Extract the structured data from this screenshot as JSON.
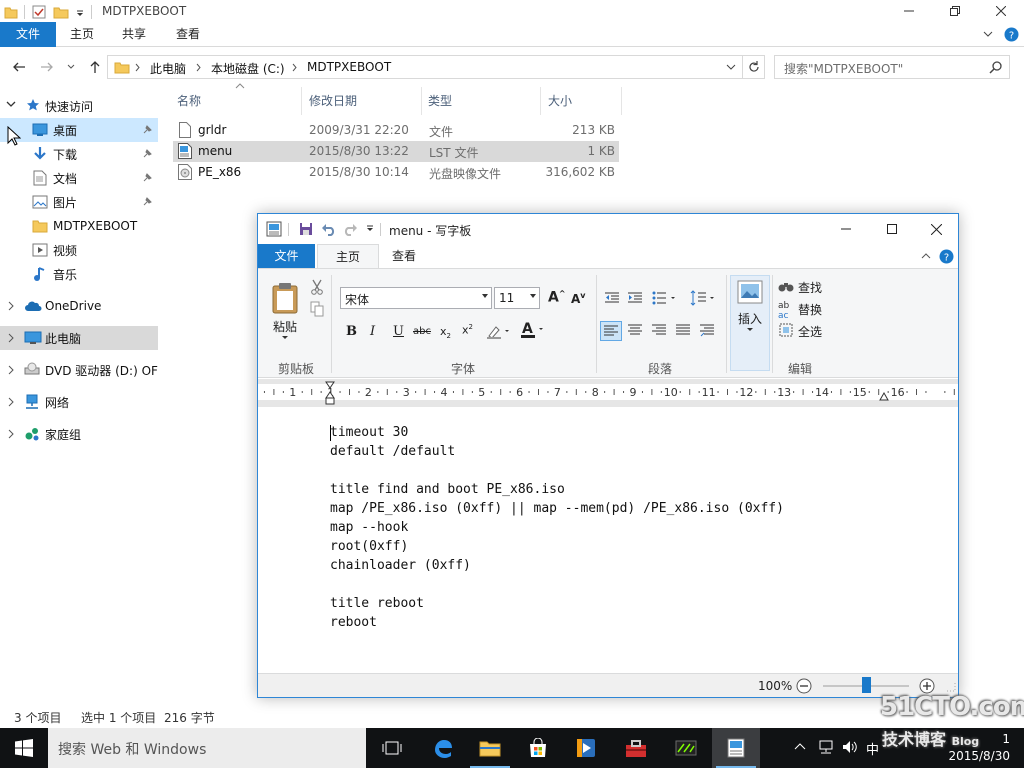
{
  "explorer": {
    "title": "MDTPXEBOOT",
    "tabs": {
      "file": "文件",
      "home": "主页",
      "share": "共享",
      "view": "查看"
    },
    "breadcrumb": [
      "此电脑",
      "本地磁盘 (C:)",
      "MDTPXEBOOT"
    ],
    "search_placeholder": "搜索\"MDTPXEBOOT\"",
    "nav": {
      "quick_access": "快速访问",
      "desktop": "桌面",
      "downloads": "下载",
      "documents": "文档",
      "pictures": "图片",
      "mdt": "MDTPXEBOOT",
      "videos": "视频",
      "music": "音乐",
      "onedrive": "OneDrive",
      "thispc": "此电脑",
      "dvd": "DVD 驱动器 (D:) OF",
      "network": "网络",
      "homegroup": "家庭组"
    },
    "columns": {
      "name": "名称",
      "date": "修改日期",
      "type": "类型",
      "size": "大小"
    },
    "files": [
      {
        "name": "grldr",
        "date": "2009/3/31 22:20",
        "type": "文件",
        "size": "213 KB"
      },
      {
        "name": "menu",
        "date": "2015/8/30 13:22",
        "type": "LST 文件",
        "size": "1 KB"
      },
      {
        "name": "PE_x86",
        "date": "2015/8/30 10:14",
        "type": "光盘映像文件",
        "size": "316,602 KB"
      }
    ],
    "status": {
      "count": "3 个项目",
      "selected": "选中 1 个项目",
      "size": "216 字节"
    }
  },
  "wordpad": {
    "title": "menu - 写字板",
    "tabs": {
      "file": "文件",
      "home": "主页",
      "view": "查看"
    },
    "clipboard": {
      "paste": "粘贴",
      "label": "剪贴板"
    },
    "font": {
      "name": "宋体",
      "size": "11",
      "label": "字体"
    },
    "paragraph_label": "段落",
    "insert": {
      "label": "插入"
    },
    "edit": {
      "find": "查找",
      "replace": "替换",
      "select_all": "全选",
      "label": "编辑"
    },
    "ruler": [
      "1",
      "1",
      "2",
      "3",
      "4",
      "5",
      "6",
      "7",
      "8",
      "9",
      "10",
      "11",
      "12",
      "13",
      "14",
      "15",
      "16"
    ],
    "content": "timeout 30\ndefault /default\n\ntitle find and boot PE_x86.iso\nmap /PE_x86.iso (0xff) || map --mem(pd) /PE_x86.iso (0xff)\nmap --hook\nroot(0xff)\nchainloader (0xff)\n\ntitle reboot\nreboot",
    "zoom": "100%",
    "zoom_level": 0.5
  },
  "taskbar": {
    "search": "搜索 Web 和 Windows",
    "date": "2015/8/30",
    "time": "1"
  },
  "watermark": {
    "site": "51CTO.com",
    "sub": "技术博客",
    "blog": "Blog"
  }
}
